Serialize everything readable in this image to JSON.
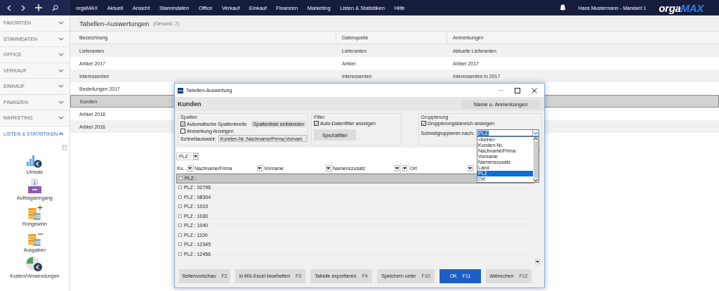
{
  "topbar": {
    "menu": [
      "orgaMAX",
      "Aktuell",
      "Ansicht",
      "Stammdaten",
      "Office",
      "Verkauf",
      "Einkauf",
      "Finanzen",
      "Marketing",
      "Listen & Statistiken",
      "Hilfe"
    ],
    "user": "Hans Mustermann - Mandant 1",
    "logo": {
      "lead": "orga",
      "accent": "MAX"
    }
  },
  "sidebar": {
    "sections": [
      {
        "label": "FAVORITEN",
        "expanded": false
      },
      {
        "label": "STAMMDATEN",
        "expanded": false
      },
      {
        "label": "OFFICE",
        "expanded": false
      },
      {
        "label": "VERKAUF",
        "expanded": false
      },
      {
        "label": "EINKAUF",
        "expanded": false
      },
      {
        "label": "FINANZEN",
        "expanded": false
      },
      {
        "label": "MARKETING",
        "expanded": false
      },
      {
        "label": "LISTEN & STATISTIKEN",
        "expanded": true
      }
    ],
    "items": [
      {
        "label": "Umsatz",
        "kind": "revenue"
      },
      {
        "label": "Auftragseingang",
        "kind": "inbox"
      },
      {
        "label": "Rohgewinn",
        "kind": "plus"
      },
      {
        "label": "Ausgaben",
        "kind": "minus"
      },
      {
        "label": "Kosten/Verwendungen",
        "kind": "pie"
      }
    ]
  },
  "page": {
    "title": "Tabellen-Auswertungen",
    "count": "(Gesamt: 7)"
  },
  "table": {
    "columns": [
      "Bezeichnung",
      "Datenquelle",
      "Anmerkungen"
    ],
    "rows": [
      {
        "cells": [
          "Lieferanten",
          "Lieferanten",
          "Aktuelle Lieferanten"
        ],
        "selected": false
      },
      {
        "cells": [
          "Artikel 2017",
          "Artikel",
          "Artikel 2017"
        ],
        "selected": false
      },
      {
        "cells": [
          "Interessenten",
          "Interessenten",
          "Interessenten in 2017"
        ],
        "selected": false
      },
      {
        "cells": [
          "Bestellungen 2017"
        ],
        "selected": false
      },
      {
        "cells": [
          "Kunden"
        ],
        "selected": true
      },
      {
        "cells": [
          "Artikel 2018"
        ],
        "selected": false
      },
      {
        "cells": [
          "Artikel 2016"
        ],
        "selected": false
      }
    ]
  },
  "dialog": {
    "title": "Tabellen-Auswertung",
    "heading": "Kunden",
    "name_button": "Name u. Anmerkungen",
    "columns_group": {
      "title": "Spalten",
      "auto_width": {
        "label": "Automatische Spaltenbreite",
        "checked": true
      },
      "list_button": "Spaltenliste einblenden",
      "note": {
        "label": "Anmerkung Anzeigen",
        "checked": false
      },
      "quick_label": "Schnellauswahl:",
      "quick_value": "Kunden-Nr.;Nachname/Firma;Vornam"
    },
    "filter_group": {
      "title": "Filter",
      "auto_filter": {
        "label": "Auto-Datenfilter anzeigen",
        "checked": true
      },
      "special_button": "Spezialfilter"
    },
    "grouping_group": {
      "title": "Gruppierung",
      "show_area": {
        "label": "Gruppierungsbereich anzeigen",
        "checked": true
      },
      "quick_label": "Schnellgruppieren nach:",
      "value": "PLZ",
      "options": [
        {
          "label": "<keine>",
          "selected": false
        },
        {
          "label": "Kunden-Nr.",
          "selected": false
        },
        {
          "label": "Nachname/Firma",
          "selected": false
        },
        {
          "label": "Vorname",
          "selected": false
        },
        {
          "label": "Namenszusatz",
          "selected": false
        },
        {
          "label": "Land",
          "selected": false
        },
        {
          "label": "PLZ",
          "selected": true
        },
        {
          "label": "Ort",
          "selected": false
        }
      ]
    },
    "group_chip": "PLZ",
    "grid_columns": [
      {
        "label": "Ku..."
      },
      {
        "label": "Nachname/Firma"
      },
      {
        "label": "Vorname"
      },
      {
        "label": "Namenszusatz"
      },
      {
        "kind": "narrow"
      },
      {
        "label": "Ort"
      }
    ],
    "grid_rows": [
      {
        "label": "PLZ :",
        "selected": true
      },
      {
        "label": "PLZ : 02796",
        "selected": false
      },
      {
        "label": "PLZ : 08304",
        "selected": false
      },
      {
        "label": "PLZ : 1010",
        "selected": false
      },
      {
        "label": "PLZ : 1030",
        "selected": false
      },
      {
        "label": "PLZ : 1040",
        "selected": false
      },
      {
        "label": "PLZ : 1100",
        "selected": false
      },
      {
        "label": "PLZ : 12345",
        "selected": false
      },
      {
        "label": "PLZ : 12456",
        "selected": false
      }
    ],
    "buttons": [
      {
        "label": "Seitenvorschau",
        "key": "F2",
        "primary": false
      },
      {
        "label": "in MS-Excel bearbeiten",
        "key": "F3",
        "primary": false
      },
      {
        "label": "Tabelle exportieren",
        "key": "F4",
        "primary": false
      },
      {
        "label": "Speichern unter",
        "key": "F10",
        "primary": false
      },
      {
        "label": "OK",
        "key": "F11",
        "primary": true
      },
      {
        "label": "Abbrechen",
        "key": "F12",
        "primary": false
      }
    ]
  }
}
